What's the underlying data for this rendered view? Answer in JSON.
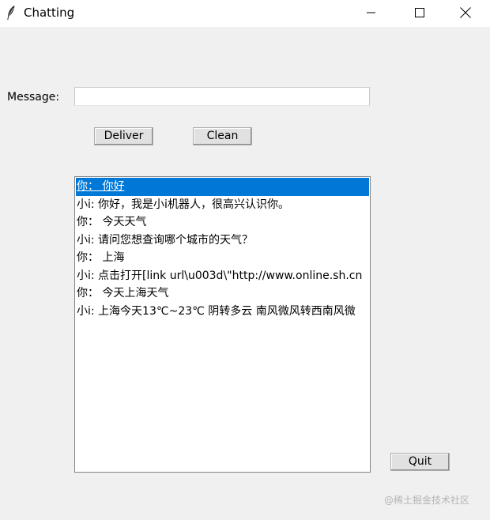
{
  "window": {
    "title": "Chatting",
    "icon": "feather-icon",
    "controls": [
      "minimize-icon",
      "maximize-icon",
      "close-icon"
    ]
  },
  "form": {
    "message_label": "Message:",
    "message_value": "",
    "deliver_label": "Deliver",
    "clean_label": "Clean",
    "quit_label": "Quit"
  },
  "chat": {
    "selected_index": 0,
    "selection_color": "#0078d7",
    "lines": [
      "你：  你好",
      "小i: 你好，我是小i机器人，很高兴认识你。",
      "你：  今天天气",
      "小i: 请问您想查询哪个城市的天气？",
      "你：  上海",
      "小i: 点击打开[link url\\u003d\\\"http://www.online.sh.cn",
      "你：  今天上海天气",
      "小i: 上海今天13℃~23℃ 阴转多云 南风微风转西南风微"
    ]
  },
  "watermark": "@稀土掘金技术社区"
}
